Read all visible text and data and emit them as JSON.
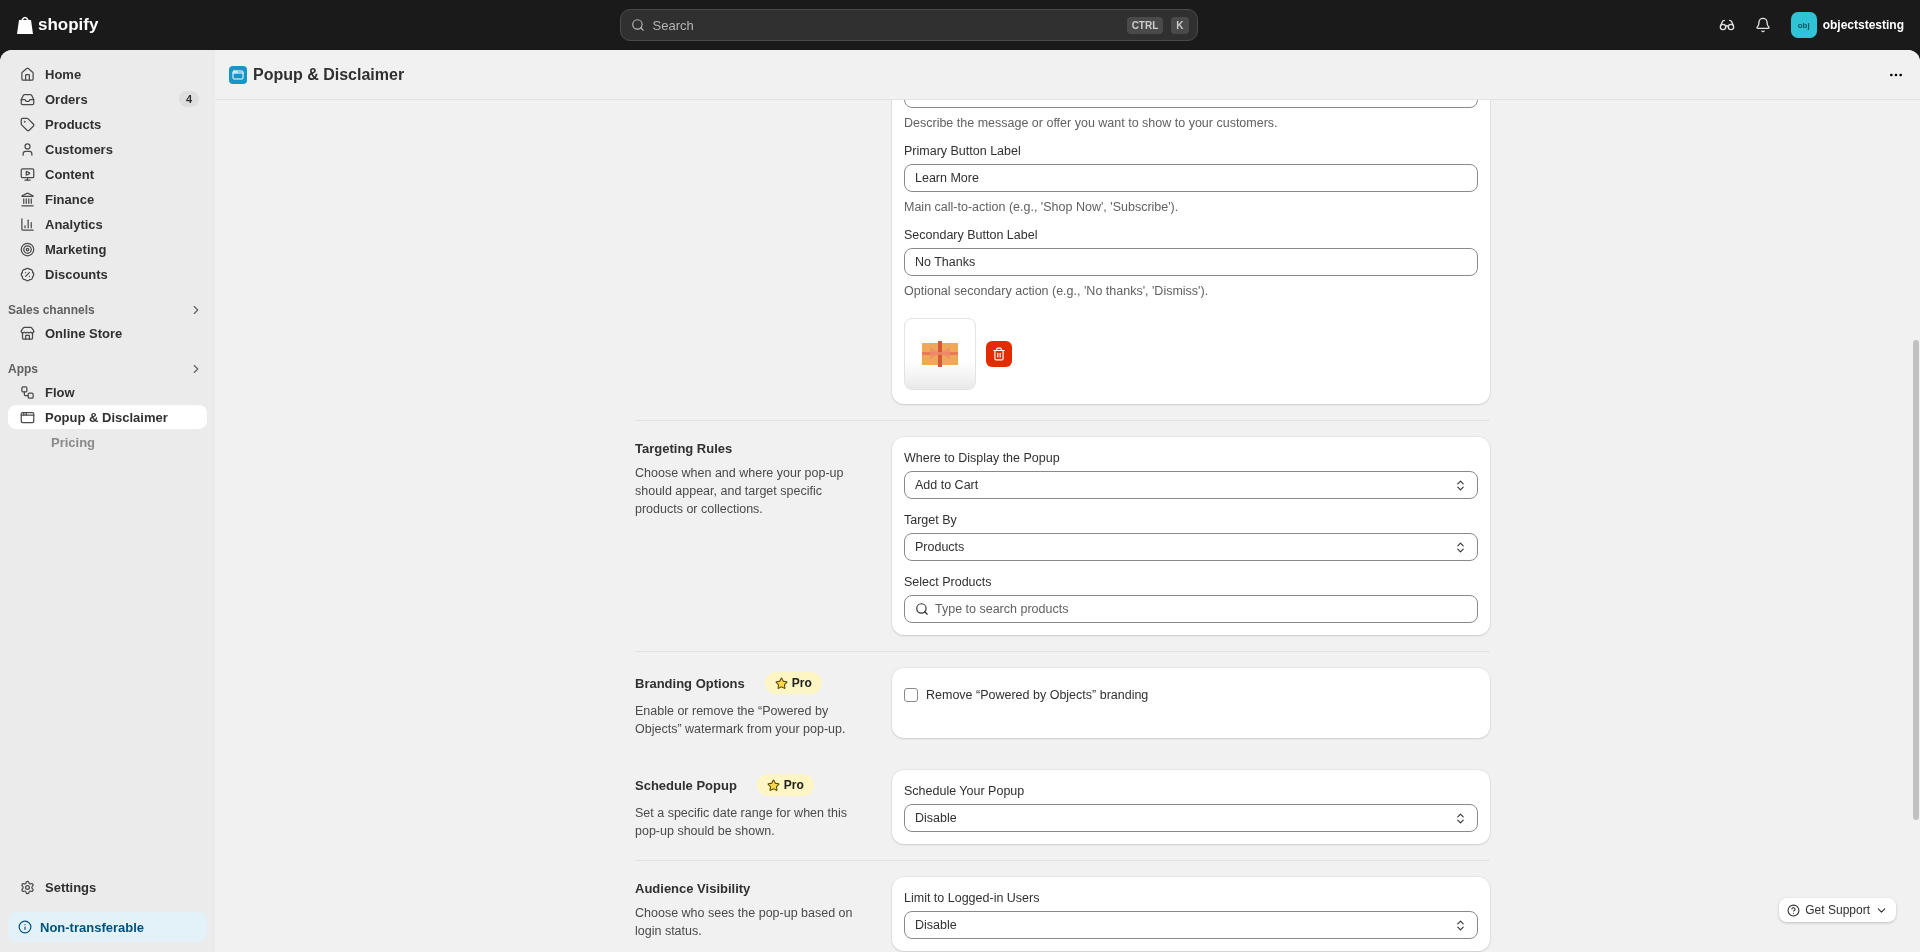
{
  "topbar": {
    "brand": "shopify",
    "search": {
      "placeholder": "Search",
      "keys": [
        "CTRL",
        "K"
      ]
    },
    "store": {
      "initials": "obj",
      "name": "objectstesting"
    }
  },
  "sidebar": {
    "items": [
      {
        "label": "Home",
        "selected": false
      },
      {
        "label": "Orders",
        "badge": "4",
        "selected": false
      },
      {
        "label": "Products",
        "selected": false
      },
      {
        "label": "Customers",
        "selected": false
      },
      {
        "label": "Content",
        "selected": false
      },
      {
        "label": "Finance",
        "selected": false
      },
      {
        "label": "Analytics",
        "selected": false
      },
      {
        "label": "Marketing",
        "selected": false
      },
      {
        "label": "Discounts",
        "selected": false
      }
    ],
    "groups": [
      {
        "title": "Sales channels",
        "items": [
          {
            "label": "Online Store",
            "selected": false
          }
        ]
      },
      {
        "title": "Apps",
        "items": [
          {
            "label": "Flow",
            "selected": false
          },
          {
            "label": "Popup & Disclaimer",
            "selected": true,
            "children": [
              {
                "label": "Pricing",
                "selected": false
              }
            ]
          }
        ]
      }
    ],
    "settings": {
      "label": "Settings"
    },
    "notice": {
      "label": "Non-transferable"
    }
  },
  "page": {
    "title": "Popup & Disclaimer"
  },
  "sections": [
    {
      "fields": [
        {
          "kind": "textarea",
          "helper": "Describe the message or offer you want to show to your customers."
        },
        {
          "kind": "text",
          "label": "Primary Button Label",
          "value": "Learn More",
          "helper": "Main call-to-action (e.g., 'Shop Now', 'Subscribe')."
        },
        {
          "kind": "text",
          "label": "Secondary Button Label",
          "value": "No Thanks",
          "helper": "Optional secondary action (e.g., 'No thanks', 'Dismiss')."
        },
        {
          "kind": "image"
        }
      ]
    },
    {
      "title": "Targeting Rules",
      "description": "Choose when and where your pop-up should appear, and target specific products or collections.",
      "fields": [
        {
          "kind": "select",
          "label": "Where to Display the Popup",
          "value": "Add to Cart"
        },
        {
          "kind": "select",
          "label": "Target By",
          "value": "Products"
        },
        {
          "kind": "search",
          "label": "Select Products",
          "placeholder": "Type to search products"
        }
      ]
    },
    {
      "title": "Branding Options",
      "badge": "Pro",
      "description": "Enable or remove the “Powered by Objects” watermark from your pop-up.",
      "fields": [
        {
          "kind": "checkbox",
          "label": "Remove “Powered by Objects” branding",
          "checked": false
        }
      ]
    },
    {
      "title": "Schedule Popup",
      "badge": "Pro",
      "description": "Set a specific date range for when this pop-up should be shown.",
      "fields": [
        {
          "kind": "select",
          "label": "Schedule Your Popup",
          "value": "Disable"
        }
      ]
    },
    {
      "title": "Audience Visibility",
      "description": "Choose who sees the pop-up based on login status.",
      "fields": [
        {
          "kind": "select",
          "label": "Limit to Logged-in Users",
          "value": "Disable"
        }
      ]
    }
  ],
  "support": {
    "label": "Get Support"
  }
}
